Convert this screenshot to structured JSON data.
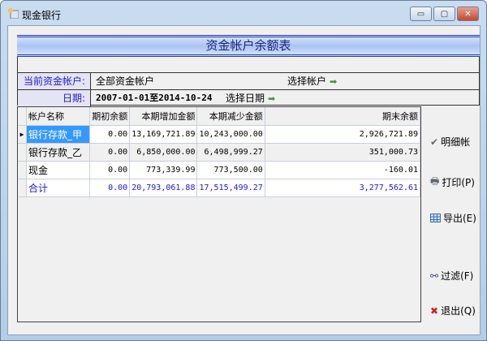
{
  "window": {
    "title": "现金银行",
    "minimize": "▭",
    "maximize": "▢",
    "close": "✕"
  },
  "report": {
    "title": "资金帐户余额表"
  },
  "filter": {
    "account_label": "当前资金帐户:",
    "account_value": "全部资金帐户",
    "select_account": "选择帐户",
    "date_label": "日期:",
    "date_value": "2007-01-01至2014-10-24",
    "select_date": "选择日期"
  },
  "table": {
    "headers": [
      "帐户名称",
      "期初余额",
      "本期增加金额",
      "本期减少金额",
      "期末余额"
    ],
    "rows": [
      [
        "银行存款_甲",
        "0.00",
        "13,169,721.89",
        "10,243,000.00",
        "2,926,721.89"
      ],
      [
        "银行存款_乙",
        "0.00",
        "6,850,000.00",
        "6,498,999.27",
        "351,000.73"
      ],
      [
        "现金",
        "0.00",
        "773,339.99",
        "773,500.00",
        "-160.01"
      ]
    ],
    "total": [
      "合计",
      "0.00",
      "20,793,061.88",
      "17,515,499.27",
      "3,277,562.61"
    ]
  },
  "actions": {
    "detail": "明细帐",
    "print": "打印(P)",
    "export": "导出(E)",
    "filter": "过滤(F)",
    "exit": "退出(Q)"
  }
}
